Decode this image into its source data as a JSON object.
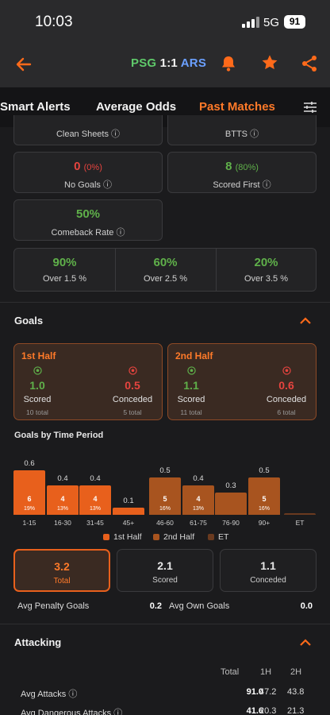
{
  "status_bar": {
    "time": "10:03",
    "network": "5G",
    "battery": "91"
  },
  "header": {
    "home": "PSG",
    "score": "1:1",
    "away": "ARS",
    "back_icon": "back-arrow-icon",
    "bell_icon": "bell-icon",
    "star_icon": "star-icon",
    "share_icon": "share-icon"
  },
  "tabs": [
    {
      "label": "Smart Alerts"
    },
    {
      "label": "Average Odds"
    },
    {
      "label": "Past Matches"
    }
  ],
  "active_tab": "Past Matches",
  "filter_icon": "sliders-icon",
  "top_cards": {
    "clean_sheets": "Clean Sheets",
    "btts": "BTTS",
    "no_goals": {
      "value": "0",
      "pct": "(0%)",
      "label": "No Goals"
    },
    "scored_first": {
      "value": "8",
      "pct": "(80%)",
      "label": "Scored First"
    },
    "comeback": {
      "value": "50%",
      "label": "Comeback Rate"
    }
  },
  "over": [
    {
      "value": "90%",
      "label": "Over 1.5 %"
    },
    {
      "value": "60%",
      "label": "Over 2.5 %"
    },
    {
      "value": "20%",
      "label": "Over 3.5 %"
    }
  ],
  "goals_section": {
    "title": "Goals",
    "chevron_icon": "chevron-up-icon"
  },
  "halves": [
    {
      "label": "1st Half",
      "scored": "1.0",
      "conceded": "0.5",
      "scored_label": "Scored",
      "conceded_label": "Conceded",
      "scored_total": "10 total",
      "conceded_total": "5 total"
    },
    {
      "label": "2nd Half",
      "scored": "1.1",
      "conceded": "0.6",
      "scored_label": "Scored",
      "conceded_label": "Conceded",
      "scored_total": "11 total",
      "conceded_total": "6 total"
    }
  ],
  "time_period_title": "Goals by Time Period",
  "chart_data": {
    "type": "bar",
    "categories": [
      "1-15",
      "16-30",
      "31-45",
      "45+",
      "46-60",
      "61-75",
      "76-90",
      "90+",
      "ET"
    ],
    "values": [
      0.6,
      0.4,
      0.4,
      0.1,
      0.5,
      0.4,
      0.3,
      0.5,
      0
    ],
    "value_labels": [
      "0.6",
      "0.4",
      "0.4",
      "0.1",
      "0.5",
      "0.4",
      "0.3",
      "0.5",
      ""
    ],
    "counts": [
      "6",
      "4",
      "4",
      "",
      "5",
      "4",
      "",
      "5",
      ""
    ],
    "percents": [
      "19%",
      "13%",
      "13%",
      "",
      "16%",
      "13%",
      "",
      "16%",
      ""
    ],
    "groups": [
      "1st Half",
      "1st Half",
      "1st Half",
      "1st Half",
      "2nd Half",
      "2nd Half",
      "2nd Half",
      "2nd Half",
      "ET"
    ],
    "legend": [
      "1st Half",
      "2nd Half",
      "ET"
    ],
    "colors": {
      "1st Half": "#e8601c",
      "2nd Half": "#a8541f",
      "ET": "#6a3a1f"
    },
    "ylim": [
      0,
      0.6
    ]
  },
  "totals": [
    {
      "value": "3.2",
      "label": "Total"
    },
    {
      "value": "2.1",
      "label": "Scored"
    },
    {
      "value": "1.1",
      "label": "Conceded"
    }
  ],
  "penalty": {
    "label": "Avg Penalty Goals",
    "value": "0.2"
  },
  "own_goals": {
    "label": "Avg Own Goals",
    "value": "0.0"
  },
  "attacking": {
    "title": "Attacking",
    "headers": [
      "Total",
      "1H",
      "2H"
    ],
    "rows": [
      {
        "label": "Avg Attacks",
        "total": "91.0",
        "h1": "47.2",
        "h2": "43.8"
      },
      {
        "label": "Avg Dangerous Attacks",
        "total": "41.6",
        "h1": "20.3",
        "h2": "21.3"
      }
    ]
  }
}
